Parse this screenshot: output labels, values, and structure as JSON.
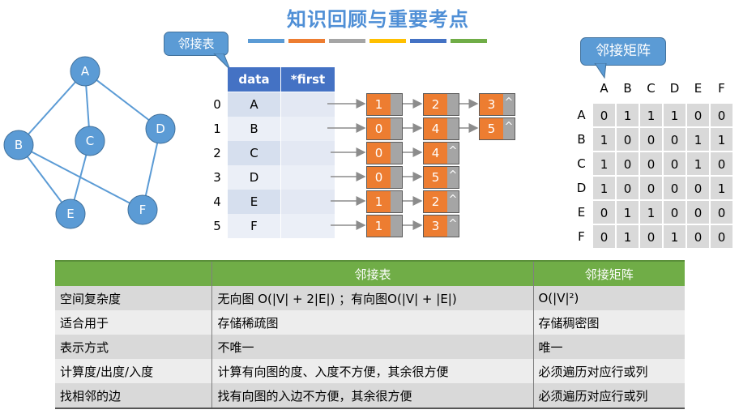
{
  "title": "知识回顾与重要考点",
  "colors": {
    "title": "#4F8FD6",
    "accent_blue": "#5B9BD5",
    "orange": "#ED7D31",
    "gray": "#A5A5A5",
    "green": "#70AD47",
    "head_blue": "#4472C4"
  },
  "color_bars": [
    "#5B9BD5",
    "#ED7D31",
    "#A5A5A5",
    "#FFC000",
    "#4472C4",
    "#70AD47"
  ],
  "callouts": {
    "adj_list": "邻接表",
    "adj_matrix": "邻接矩阵"
  },
  "graph": {
    "vertices": [
      "A",
      "B",
      "C",
      "D",
      "E",
      "F"
    ],
    "edges": [
      [
        "A",
        "B"
      ],
      [
        "A",
        "C"
      ],
      [
        "A",
        "D"
      ],
      [
        "B",
        "E"
      ],
      [
        "B",
        "F"
      ],
      [
        "C",
        "E"
      ],
      [
        "D",
        "F"
      ]
    ]
  },
  "adj_list": {
    "headers": [
      "data",
      "*first"
    ],
    "rows": [
      {
        "index": "0",
        "data": "A",
        "nodes": [
          "1",
          "2",
          "3"
        ]
      },
      {
        "index": "1",
        "data": "B",
        "nodes": [
          "0",
          "4",
          "5"
        ]
      },
      {
        "index": "2",
        "data": "C",
        "nodes": [
          "0",
          "4"
        ]
      },
      {
        "index": "3",
        "data": "D",
        "nodes": [
          "0",
          "5"
        ]
      },
      {
        "index": "4",
        "data": "E",
        "nodes": [
          "1",
          "2"
        ]
      },
      {
        "index": "5",
        "data": "F",
        "nodes": [
          "1",
          "3"
        ]
      }
    ],
    "null_symbol": "^"
  },
  "adj_matrix": {
    "labels": [
      "A",
      "B",
      "C",
      "D",
      "E",
      "F"
    ],
    "rows": [
      [
        "0",
        "1",
        "1",
        "1",
        "0",
        "0"
      ],
      [
        "1",
        "0",
        "0",
        "0",
        "1",
        "1"
      ],
      [
        "1",
        "0",
        "0",
        "0",
        "1",
        "0"
      ],
      [
        "1",
        "0",
        "0",
        "0",
        "0",
        "1"
      ],
      [
        "0",
        "1",
        "1",
        "0",
        "0",
        "0"
      ],
      [
        "0",
        "1",
        "0",
        "1",
        "0",
        "0"
      ]
    ]
  },
  "comparison": {
    "headers": [
      "",
      "邻接表",
      "邻接矩阵"
    ],
    "rows": [
      [
        "空间复杂度",
        "无向图 O(|V| + 2|E|) ；有向图O(|V| + |E|)",
        "O(|V|²)"
      ],
      [
        "适合用于",
        "存储稀疏图",
        "存储稠密图"
      ],
      [
        "表示方式",
        "不唯一",
        "唯一"
      ],
      [
        "计算度/出度/入度",
        "计算有向图的度、入度不方便，其余很方便",
        "必须遍历对应行或列"
      ],
      [
        "找相邻的边",
        "找有向图的入边不方便，其余很方便",
        "必须遍历对应行或列"
      ]
    ]
  }
}
